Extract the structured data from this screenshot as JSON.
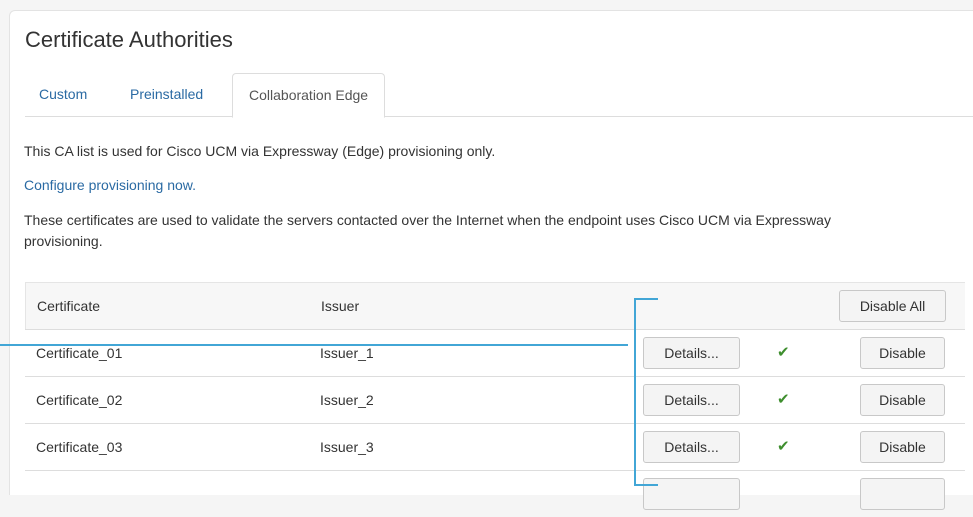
{
  "page": {
    "title": "Certificate Authorities",
    "tabs": [
      {
        "label": "Custom"
      },
      {
        "label": "Preinstalled"
      },
      {
        "label": "Collaboration Edge",
        "active": true
      }
    ],
    "intro": "This CA list is used for Cisco UCM via Expressway (Edge) provisioning only.",
    "configure_link": "Configure provisioning now.",
    "description": "These certificates are used to validate the servers contacted over the Internet when the endpoint uses Cisco UCM via Expressway provisioning."
  },
  "table": {
    "headers": {
      "certificate": "Certificate",
      "issuer": "Issuer"
    },
    "disable_all_label": "Disable All",
    "rows": [
      {
        "certificate": "Certificate_01",
        "issuer": "Issuer_1",
        "details_label": "Details...",
        "status": "enabled",
        "disable_label": "Disable"
      },
      {
        "certificate": "Certificate_02",
        "issuer": "Issuer_2",
        "details_label": "Details...",
        "status": "enabled",
        "disable_label": "Disable"
      },
      {
        "certificate": "Certificate_03",
        "issuer": "Issuer_3",
        "details_label": "Details...",
        "status": "enabled",
        "disable_label": "Disable"
      }
    ]
  },
  "colors": {
    "link": "#2a6aa3",
    "check": "#3e8e2e",
    "callout": "#42a6d6"
  },
  "icons": {
    "status_enabled": "checkmark-icon"
  }
}
